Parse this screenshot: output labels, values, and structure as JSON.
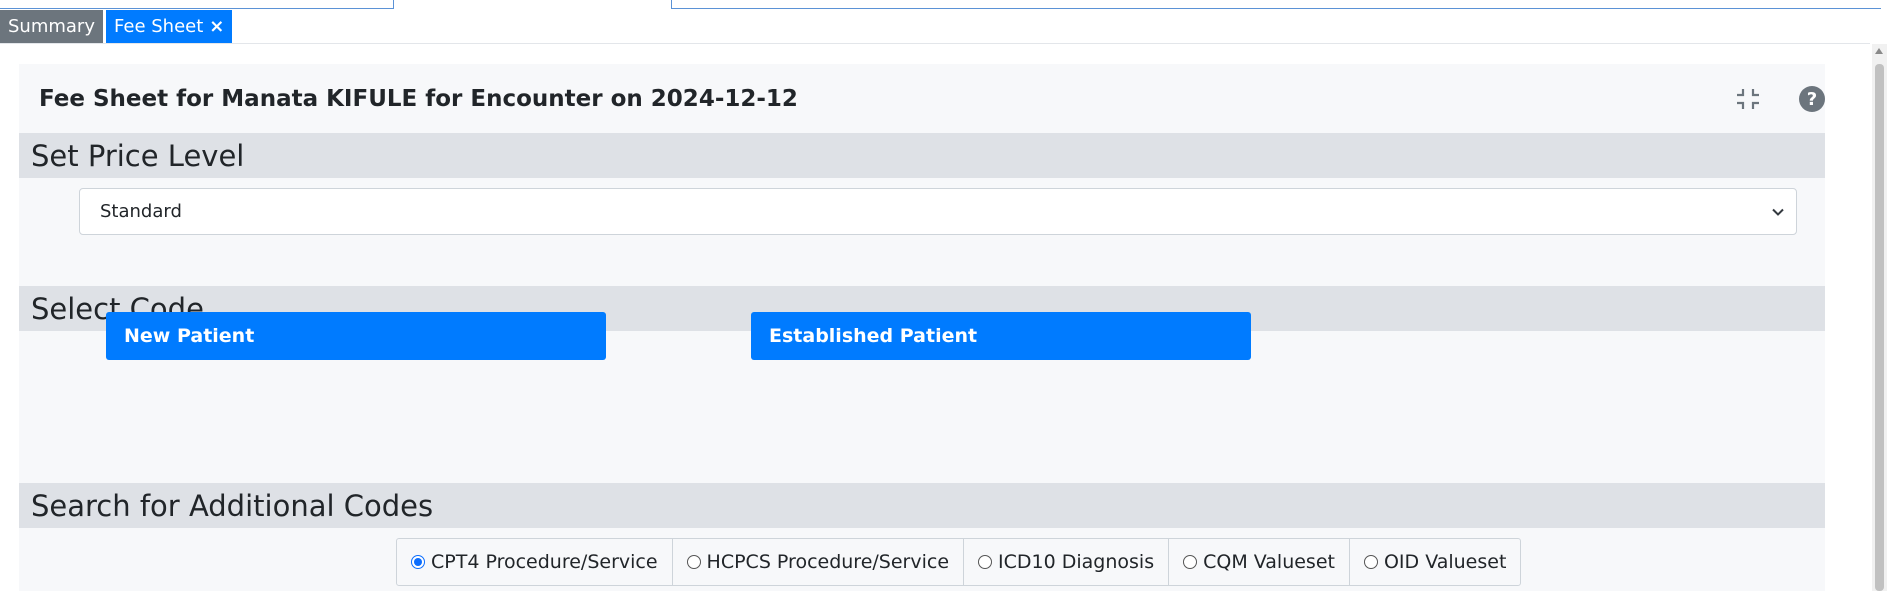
{
  "tabs": [
    {
      "label": "Summary"
    },
    {
      "label": "Fee Sheet",
      "close": "×"
    }
  ],
  "header": {
    "title": "Fee Sheet for Manata KIFULE for Encounter on 2024-12-12",
    "help_glyph": "?"
  },
  "price_level": {
    "heading": "Set Price Level",
    "selected": "Standard"
  },
  "select_code": {
    "heading": "Select Code",
    "new_patient": "New Patient",
    "established_patient": "Established Patient"
  },
  "search": {
    "heading": "Search for Additional Codes",
    "options": [
      {
        "label": "CPT4 Procedure/Service",
        "checked": true
      },
      {
        "label": "HCPCS Procedure/Service",
        "checked": false
      },
      {
        "label": "ICD10 Diagnosis",
        "checked": false
      },
      {
        "label": "CQM Valueset",
        "checked": false
      },
      {
        "label": "OID Valueset",
        "checked": false
      }
    ]
  },
  "colors": {
    "accent": "#007bff",
    "tab_inactive": "#6c757d",
    "section_bg": "#dee1e6"
  }
}
